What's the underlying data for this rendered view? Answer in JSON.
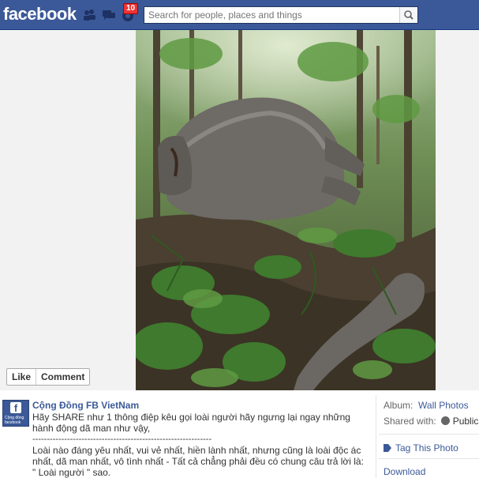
{
  "header": {
    "logo": "facebook",
    "notification_count": "10",
    "search_placeholder": "Search for people, places and things"
  },
  "photo_actions": {
    "like": "Like",
    "comment": "Comment"
  },
  "post": {
    "page_name": "Cộng Đồng FB VietNam",
    "avatar_text": "Cộng đồng facebook",
    "caption_line1": "Hãy SHARE như 1 thông điệp kêu gọi loài người hãy ngưng lại ngay những hành động dã man như vậy,",
    "separator": "--------------------------------------------------------------",
    "caption_line2": "Loài nào đáng yêu nhất, vui vẻ nhất, hiền lành nhất, nhưng cũng là loài độc ác nhất, dã man nhất, vô tình nhất - Tất cả chẳng phải đều có chung câu trả lời là: \" Loài người \" sao."
  },
  "sidebar": {
    "album_label": "Album:",
    "album_value": "Wall Photos",
    "shared_label": "Shared with:",
    "shared_value": "Public",
    "tag_photo": "Tag This Photo",
    "download": "Download"
  },
  "colors": {
    "brand_blue": "#3b5998",
    "badge_red": "#e33"
  },
  "icons": [
    "friend-requests-icon",
    "messages-icon",
    "notifications-icon",
    "search-icon",
    "globe-icon",
    "tag-icon"
  ]
}
